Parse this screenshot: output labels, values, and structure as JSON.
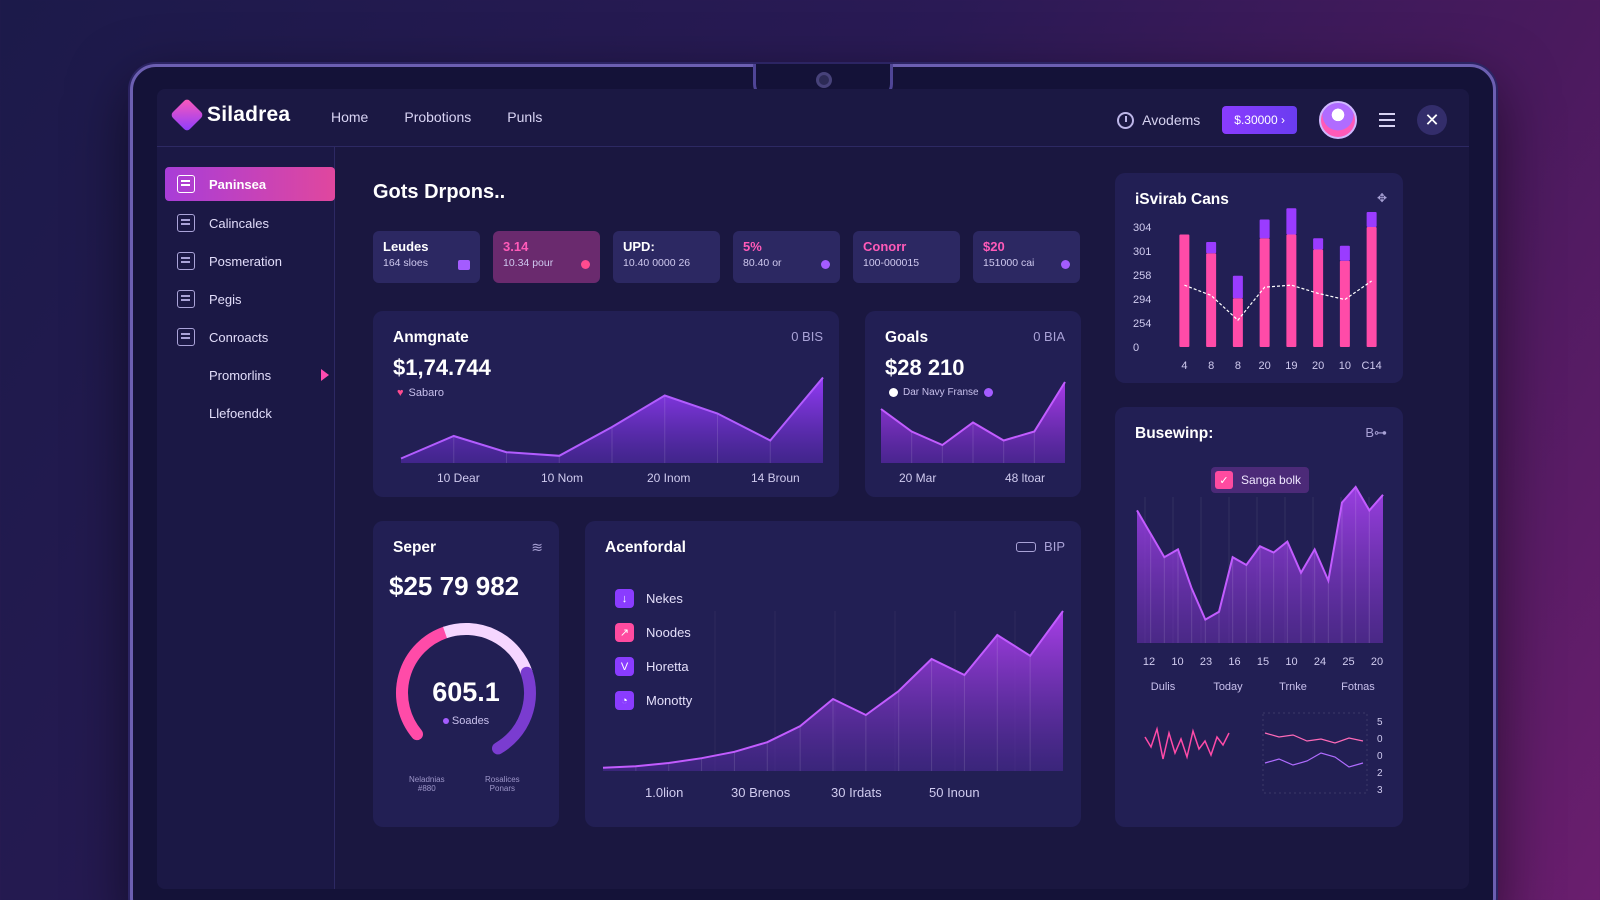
{
  "app": {
    "name": "Siladrea"
  },
  "nav": [
    "Home",
    "Probotions",
    "Punls"
  ],
  "topbar": {
    "account_label": "Avodems",
    "price_button": "$.30000 ›",
    "close_glyph": "✕"
  },
  "sidebar": {
    "items": [
      {
        "label": "Paninsea",
        "active": true
      },
      {
        "label": "Calincales"
      },
      {
        "label": "Posmeration"
      },
      {
        "label": "Pegis"
      },
      {
        "label": "Conroacts"
      },
      {
        "label": "Promorlins",
        "arrow": true
      },
      {
        "label": "Llefoendck"
      }
    ]
  },
  "page": {
    "title": "Gots Drpons.."
  },
  "stats": [
    {
      "title": "Leudes",
      "sub": "164 sloes",
      "style": "dark",
      "dot": "icon"
    },
    {
      "title": "3.14",
      "sub": "10.34 pour",
      "style": "pink",
      "dot": "pink"
    },
    {
      "title": "UPD:",
      "sub": "10.40 0000 26",
      "style": "dark",
      "dot": ""
    },
    {
      "title": "5%",
      "sub": "80.40 or",
      "style": "dark",
      "dot": "purple",
      "highlight": true
    },
    {
      "title": "Conorr",
      "sub": "100-000015",
      "style": "dark",
      "dot": "",
      "highlight": true
    },
    {
      "title": "$20",
      "sub": "151000 cai",
      "style": "dark",
      "dot": "purple",
      "highlight": true
    }
  ],
  "card_arrangement": {
    "title": "Anmgnate",
    "tag": "0 BIS",
    "value": "$1,74.744",
    "note": "Sabaro",
    "x_labels": [
      "10 Dear",
      "10 Nom",
      "20 Inom",
      "14 Broun"
    ]
  },
  "card_goals": {
    "title": "Goals",
    "tag": "0 BIA",
    "value": "$28 210",
    "note": "Dar Navy Franse",
    "x_labels": [
      "20 Mar",
      "48 ltoar"
    ]
  },
  "card_bars": {
    "title": "iSvirab Cans",
    "y_labels": [
      "304",
      "301",
      "258",
      "294",
      "254",
      "0"
    ],
    "x_labels": [
      "4",
      "8",
      "8",
      "20",
      "19",
      "20",
      "10",
      "C14"
    ]
  },
  "card_seper": {
    "title": "Seper",
    "value": "$25 79 982",
    "gauge_value": "605.1",
    "gauge_label": "Soades",
    "gauge_fraction": 0.72,
    "footer": [
      [
        "Neladnias",
        "#880"
      ],
      [
        "Rosalices",
        "Ponars"
      ]
    ]
  },
  "card_acen": {
    "title": "Acenfordal",
    "tag": "BIP",
    "legend": [
      {
        "label": "Nekes",
        "icon": "↓",
        "color": "purple"
      },
      {
        "label": "Noodes",
        "icon": "↗",
        "color": "pink"
      },
      {
        "label": "Horetta",
        "icon": "V",
        "color": "purple"
      },
      {
        "label": "Monotty",
        "icon": "◔",
        "color": "purple"
      }
    ],
    "x_labels": [
      "1.0lion",
      "30 Brenos",
      "30 Irdats",
      "50 Inoun"
    ]
  },
  "card_buse": {
    "title": "Busewinp:",
    "tag": "B⊶",
    "chip": "Sanga bolk",
    "x_labels": [
      "12",
      "10",
      "23",
      "16",
      "15",
      "10",
      "24",
      "25",
      "20"
    ],
    "period_labels": [
      "Dulis",
      "Today",
      "Trnke",
      "Fotnas"
    ],
    "mini_y": [
      "5",
      "0",
      "0",
      "2",
      "3"
    ]
  },
  "chart_data": [
    {
      "type": "area",
      "title": "Anmgnate",
      "x": [
        "10 Dear",
        "",
        "10 Nom",
        "",
        "20 Inom",
        "",
        "14 Broun",
        ""
      ],
      "series": [
        {
          "values": [
            5,
            30,
            12,
            8,
            40,
            75,
            55,
            25,
            95
          ]
        }
      ]
    },
    {
      "type": "area",
      "title": "Goals",
      "x": [
        "20 Mar",
        "",
        "",
        "48 ltoar"
      ],
      "series": [
        {
          "values": [
            60,
            35,
            20,
            45,
            25,
            35,
            90
          ]
        }
      ]
    },
    {
      "type": "bar",
      "title": "iSvirab Cans",
      "categories": [
        "4",
        "8",
        "8",
        "20",
        "19",
        "20",
        "10",
        "C14"
      ],
      "series": [
        {
          "values": [
            300,
            250,
            130,
            290,
            300,
            260,
            230,
            320
          ]
        },
        {
          "values": [
            0,
            30,
            60,
            50,
            70,
            30,
            40,
            40
          ]
        }
      ],
      "ylim": [
        0,
        320
      ]
    },
    {
      "type": "area",
      "title": "Acenfordal",
      "x": [
        "1.0lion",
        "30 Brenos",
        "30 Irdats",
        "50 Inoun"
      ],
      "series": [
        {
          "values": [
            2,
            3,
            5,
            8,
            12,
            18,
            28,
            45,
            35,
            50,
            70,
            60,
            85,
            72,
            100
          ]
        }
      ]
    },
    {
      "type": "area",
      "title": "Busewinp:",
      "x": [
        "12",
        "10",
        "23",
        "16",
        "15",
        "10",
        "24",
        "25",
        "20"
      ],
      "series": [
        {
          "values": [
            85,
            70,
            55,
            60,
            35,
            15,
            20,
            55,
            50,
            62,
            58,
            65,
            45,
            60,
            40,
            90,
            100,
            85,
            95
          ]
        }
      ]
    }
  ]
}
